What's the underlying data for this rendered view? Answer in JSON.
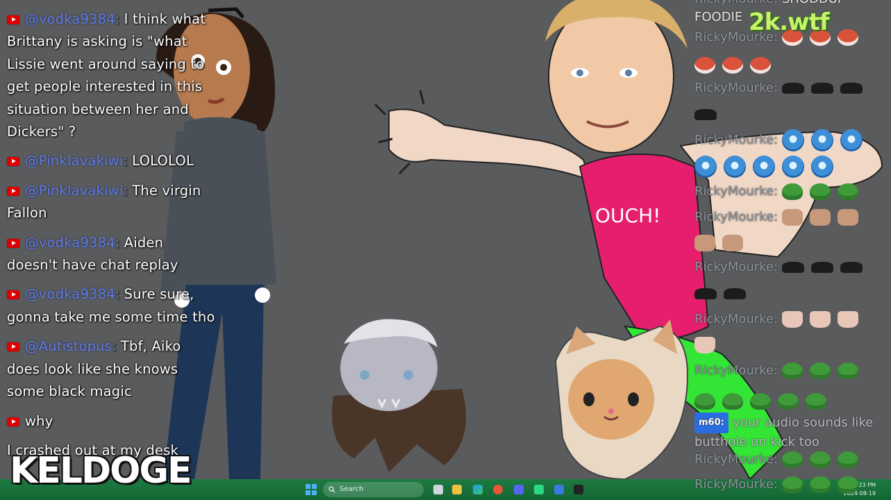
{
  "left_chat": [
    {
      "user": "@vodka9384",
      "text": "I think what Brittany is asking is \"what Lissie went around saying to get people interested in this situation between her and Dickers\" ?"
    },
    {
      "user": "@Pinklavakiwi",
      "text": "LOLOLOL"
    },
    {
      "user": "@Pinklavakiwi",
      "text": "The virgin Fallon"
    },
    {
      "user": "@vodka9384",
      "text": "Aiden doesn't have chat replay"
    },
    {
      "user": "@vodka9384",
      "text": "Sure sure, gonna take me some time tho"
    },
    {
      "user": "@Autistopus",
      "text": "Tbf, Aiko does look like she knows some black magic"
    },
    {
      "user": "",
      "text": "why"
    },
    {
      "user": "",
      "text": "I crashed out at my desk"
    }
  ],
  "right_chat": {
    "top_partial_name": "RickyMourke:",
    "top_partial_text": "SHODDUP",
    "foodie": "FOODIE",
    "username": "RickyMourke:",
    "m60_badge": "m60:",
    "m60_text": "your audio sounds like butthole on kick too",
    "emote_names": [
      "red-blob-emote",
      "cat-emote",
      "blue-face-emote",
      "pepe-cat-emote",
      "tan-cat-emote",
      "fist-emote",
      "pepe-emote"
    ]
  },
  "brand_top": "2k.wtf",
  "brand_bottom": "KELDOGE",
  "cartoon": {
    "shirt_text": "OUCH!"
  },
  "taskbar": {
    "search_placeholder": "Search",
    "clock_time": "2:23 PM",
    "clock_date": "2024-08-19"
  },
  "colors": {
    "background": "#5a5b5d",
    "taskbar": "#1d7a41",
    "username_blue": "#5f7ee6",
    "shirt_pink": "#e51f6e",
    "pants_green": "#33e636",
    "brand_green": "#c8f26a"
  }
}
